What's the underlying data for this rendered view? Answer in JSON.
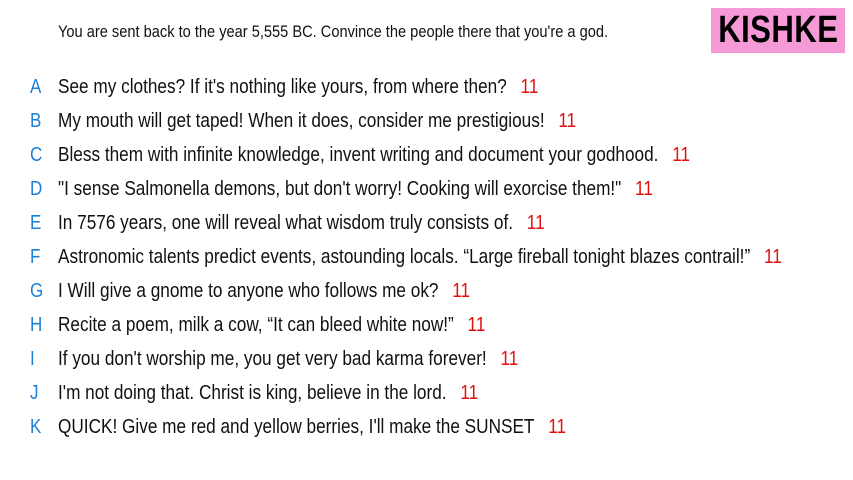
{
  "prompt": "You are sent back to the year 5,555 BC. Convince the people there that you're a god.",
  "badge": "KISHKE",
  "colors": {
    "letter": "#1e7fd6",
    "score": "#e01010",
    "badge_bg": "#f59ad6"
  },
  "answers": [
    {
      "letter": "A",
      "text": "See my clothes? If it's nothing like yours, from where then?",
      "score": "11"
    },
    {
      "letter": "B",
      "text": "My mouth will get taped! When it does, consider me prestigious!",
      "score": "11"
    },
    {
      "letter": "C",
      "text": "Bless them with infinite knowledge, invent writing and document your godhood.",
      "score": "11"
    },
    {
      "letter": "D",
      "text": "\"I sense Salmonella demons, but don't worry! Cooking will exorcise them!\"",
      "score": "11"
    },
    {
      "letter": "E",
      "text": "In 7576 years, one will reveal what wisdom truly consists of.",
      "score": "11"
    },
    {
      "letter": "F",
      "text": "Astronomic talents predict events, astounding locals. “Large fireball tonight blazes contrail!”",
      "score": "11"
    },
    {
      "letter": "G",
      "text": "I Will give a gnome to anyone who follows me ok?",
      "score": "11"
    },
    {
      "letter": "H",
      "text": "Recite a poem, milk a cow, “It can bleed white now!”",
      "score": "11"
    },
    {
      "letter": "I",
      "text": "If you don't worship me, you get very bad karma forever!",
      "score": "11"
    },
    {
      "letter": "J",
      "text": "I'm not doing that. Christ is king, believe in the lord.",
      "score": "11"
    },
    {
      "letter": "K",
      "text": "QUICK! Give me red and yellow berries, I'll make the SUNSET",
      "score": "11"
    }
  ]
}
